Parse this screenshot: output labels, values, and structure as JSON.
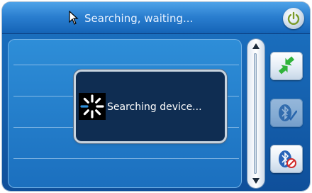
{
  "titlebar": {
    "title": "Searching, waiting...",
    "cursor_icon": "cursor-arrow-icon",
    "power_icon": "power-icon"
  },
  "dialog": {
    "message": "Searching device...",
    "icon": "loading-spinner-icon"
  },
  "sidebar": {
    "buttons": [
      {
        "icon": "reconnect-arrows-icon",
        "enabled": true
      },
      {
        "icon": "bluetooth-check-icon",
        "enabled": false
      },
      {
        "icon": "bluetooth-off-icon",
        "enabled": true
      }
    ]
  },
  "scrollbar": {
    "up_icon": "arrow-up-icon",
    "down_icon": "arrow-down-icon"
  },
  "colors": {
    "title_bar": "#2b7fd0",
    "panel": "#1b6fbe",
    "dialog_bg": "#0f2d52"
  }
}
